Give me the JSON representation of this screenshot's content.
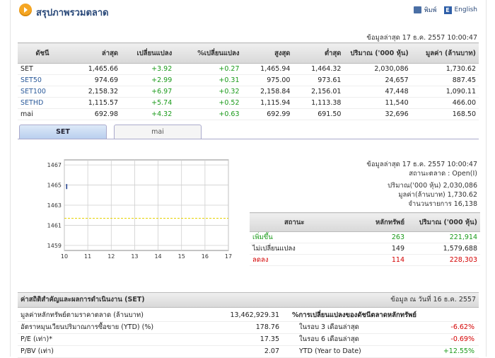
{
  "header": {
    "title": "สรุปภาพรวมตลาด",
    "print_label": "พิมพ์",
    "english_label": "English"
  },
  "update_label": "ข้อมูลล่าสุด 17 ธ.ค. 2557 10:00:47",
  "market_table": {
    "columns": [
      "ดัชนี",
      "ล่าสุด",
      "เปลี่ยนแปลง",
      "%เปลี่ยนแปลง",
      "สูงสุด",
      "ต่ำสุด",
      "ปริมาณ ('000 หุ้น)",
      "มูลค่า (ล้านบาท)"
    ],
    "rows": [
      {
        "name": "SET",
        "last": "1,465.66",
        "chg": "+3.92",
        "pchg": "+0.27",
        "high": "1,465.94",
        "low": "1,464.32",
        "vol": "2,030,086",
        "val": "1,730.62"
      },
      {
        "name": "SET50",
        "last": "974.69",
        "chg": "+2.99",
        "pchg": "+0.31",
        "high": "975.00",
        "low": "973.61",
        "vol": "24,657",
        "val": "887.45"
      },
      {
        "name": "SET100",
        "last": "2,158.32",
        "chg": "+6.97",
        "pchg": "+0.32",
        "high": "2,158.84",
        "low": "2,156.01",
        "vol": "47,448",
        "val": "1,090.11"
      },
      {
        "name": "SETHD",
        "last": "1,115.57",
        "chg": "+5.74",
        "pchg": "+0.52",
        "high": "1,115.94",
        "low": "1,113.38",
        "vol": "11,540",
        "val": "466.00"
      },
      {
        "name": "mai",
        "last": "692.98",
        "chg": "+4.32",
        "pchg": "+0.63",
        "high": "692.99",
        "low": "691.50",
        "vol": "32,696",
        "val": "168.50"
      }
    ]
  },
  "tabs": {
    "set": "SET",
    "mai": "mai"
  },
  "chart_data": {
    "type": "line",
    "x_ticks": [
      "10",
      "11",
      "12",
      "13",
      "14",
      "15",
      "16",
      "17"
    ],
    "y_ticks": [
      "1467",
      "1465",
      "1463",
      "1461",
      "1459"
    ],
    "ylim": [
      1458.5,
      1467.5
    ],
    "series": [
      {
        "values": [
          [
            10.1,
            1464.6
          ],
          [
            10.1,
            1465.1
          ]
        ]
      }
    ],
    "reference_line": 1461.7,
    "colors": {
      "line": "#1a3a8a",
      "reference": "#e6d200",
      "grid": "#cfcfcf"
    }
  },
  "set_info": {
    "update": "ข้อมูลล่าสุด 17 ธ.ค. 2557 10:00:47",
    "status": "สถานะตลาด : Open(I)",
    "volume": "ปริมาณ('000 หุ้น) 2,030,086",
    "value": "มูลค่า(ล้านบาท) 1,730.62",
    "trades": "จำนวนรายการ 16,138"
  },
  "advance_table": {
    "columns": [
      "สถานะ",
      "หลักทรัพย์",
      "ปริมาณ ('000 หุ้น)"
    ],
    "rows": [
      {
        "label": "เพิ่มขึ้น",
        "count": "263",
        "vol": "221,914"
      },
      {
        "label": "ไม่เปลี่ยนแปลง",
        "count": "149",
        "vol": "1,579,688"
      },
      {
        "label": "ลดลง",
        "count": "114",
        "vol": "228,303"
      }
    ]
  },
  "stats": {
    "title": "ค่าสถิติสำคัญและผลการดำเนินงาน (SET)",
    "as_of": "ข้อมูล ณ วันที่ 16 ธ.ค. 2557",
    "rows": [
      {
        "label": "มูลค่าหลักทรัพย์ตามราคาตลาด (ล้านบาท)",
        "value": "13,462,929.31",
        "right_label": "%การเปลี่ยนแปลงของดัชนีตลาดหลักทรัพย์",
        "right_value": ""
      },
      {
        "label": "อัตราหมุนเวียนปริมาณการซื้อขาย (YTD) (%)",
        "value": "178.76",
        "right_label": "ในรอบ 3 เดือนล่าสุด",
        "right_value": "-6.62%"
      },
      {
        "label": "P/E (เท่า)*",
        "value": "17.35",
        "right_label": "ในรอบ 6 เดือนล่าสุด",
        "right_value": "-0.69%"
      },
      {
        "label": "P/BV (เท่า)",
        "value": "2.07",
        "right_label": "YTD (Year to Date)",
        "right_value": "+12.55%"
      }
    ]
  }
}
